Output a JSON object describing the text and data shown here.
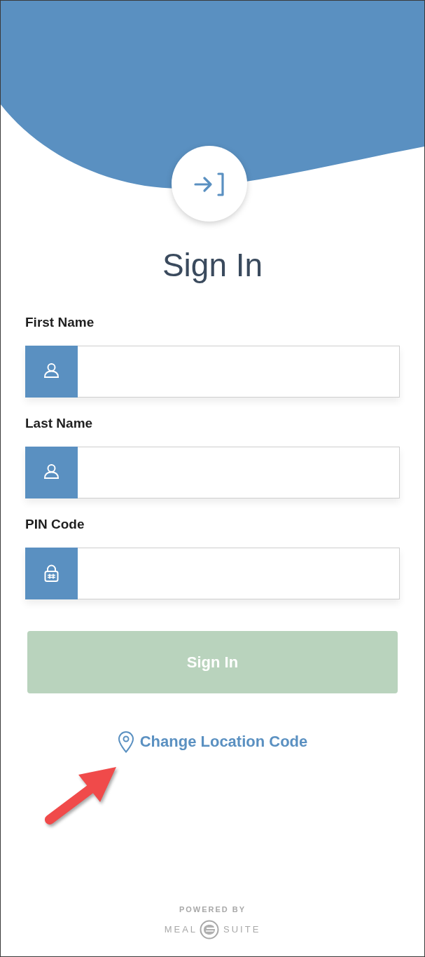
{
  "title": "Sign In",
  "fields": [
    {
      "label": "First Name",
      "kind": "person"
    },
    {
      "label": "Last Name",
      "kind": "person"
    },
    {
      "label": "PIN Code",
      "kind": "pin"
    }
  ],
  "button": {
    "label": "Sign In",
    "disabled": true
  },
  "link": {
    "label": "Change Location Code"
  },
  "footer": {
    "powered_by": "POWERED BY",
    "brand": [
      "MEAL",
      "SUITE"
    ]
  }
}
